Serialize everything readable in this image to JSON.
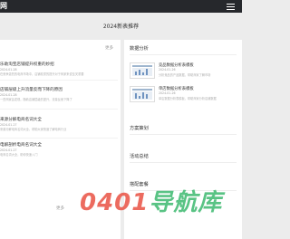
{
  "header": {
    "logo": "网"
  },
  "page_title": "2024新表推荐",
  "left": {
    "more": "更多",
    "posts": [
      {
        "title": "乐助淘宝店铺提升权重的妙招",
        "date": "2024-01-28",
        "excerpt": "在竞争激烈的电商市场中，店铺权重的提升对于商家来说至关重要"
      },
      {
        "title": "店铺层级上升流量反而下降的原因",
        "date": "2024-01-28",
        "excerpt": "一些商家会发现，随着店铺层级的提升，流量反而下降了"
      },
      {
        "title": "来源分解电商名词大全",
        "date": "2024-01-27",
        "excerpt": "来源分解电商名词大全，帮助大家快速了解电商行业"
      },
      {
        "title": "电解剖析电商名词大全",
        "date": "2024-01-27",
        "excerpt": "电商名词大全，助你快速入门"
      }
    ],
    "footer_more": "更多"
  },
  "right": {
    "sections": [
      {
        "title": "数据分析",
        "items": [
          {
            "title": "竞品数据分析表模板",
            "date": "2024-01-26",
            "excerpt": "分析竞品的产品数据，帮助商家了解市场"
          },
          {
            "title": "单店数据分析表模板",
            "date": "2024-01-26",
            "excerpt": "单店数据分析表模板，帮助商家分析店铺数据"
          }
        ]
      },
      {
        "title": "方案策划"
      },
      {
        "title": "活动总结"
      },
      {
        "title": "搭配套餐"
      }
    ]
  },
  "watermark": {
    "part1": "0401",
    "part2": "导航库"
  }
}
